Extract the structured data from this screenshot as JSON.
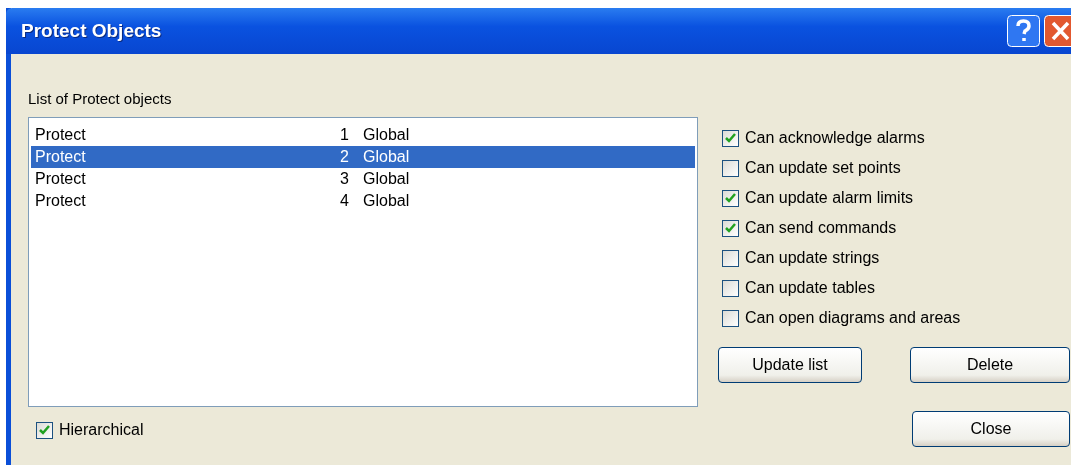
{
  "window": {
    "title": "Protect Objects"
  },
  "list_label": "List of Protect objects",
  "rows": [
    {
      "name": "Protect",
      "number": "1",
      "scope": "Global",
      "selected": false
    },
    {
      "name": "Protect",
      "number": "2",
      "scope": "Global",
      "selected": true
    },
    {
      "name": "Protect",
      "number": "3",
      "scope": "Global",
      "selected": false
    },
    {
      "name": "Protect",
      "number": "4",
      "scope": "Global",
      "selected": false
    }
  ],
  "hierarchical": {
    "label": "Hierarchical",
    "checked": true
  },
  "permissions": [
    {
      "label": "Can acknowledge alarms",
      "checked": true
    },
    {
      "label": "Can update set points",
      "checked": false
    },
    {
      "label": "Can update alarm limits",
      "checked": true
    },
    {
      "label": "Can send commands",
      "checked": true
    },
    {
      "label": "Can update strings",
      "checked": false
    },
    {
      "label": "Can update tables",
      "checked": false
    },
    {
      "label": "Can open diagrams and areas",
      "checked": false
    }
  ],
  "buttons": [
    "Update list",
    "Delete"
  ],
  "close_button": "Close"
}
